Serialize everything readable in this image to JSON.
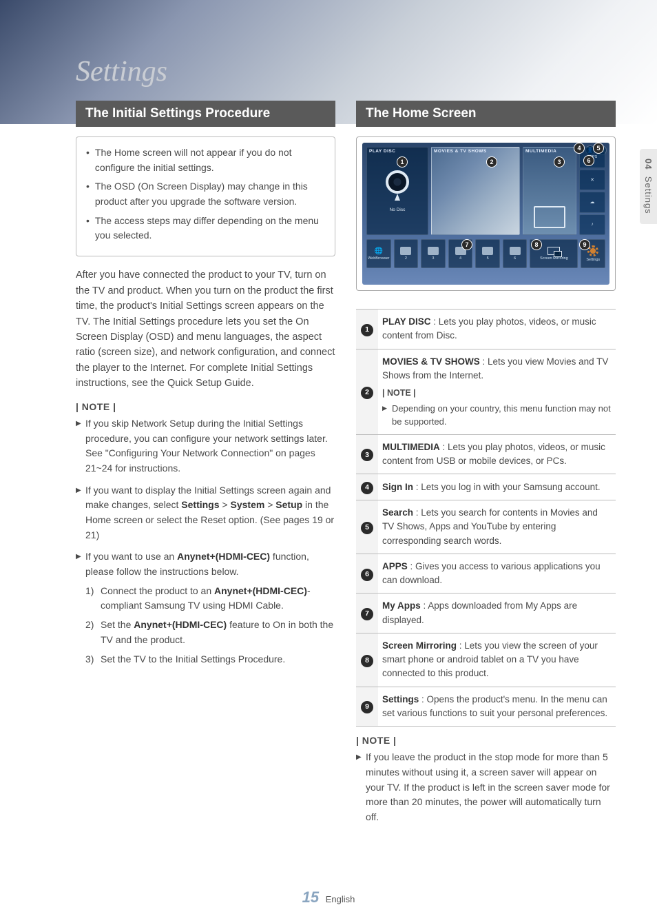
{
  "section_title": "Settings",
  "side_tab": {
    "number": "04",
    "label": "Settings"
  },
  "footer": {
    "page": "15",
    "lang": "English"
  },
  "left": {
    "heading": "The Initial Settings Procedure",
    "box_bullets": [
      "The Home screen will not appear if you do not configure the initial settings.",
      "The OSD (On Screen Display) may change in this product after you upgrade the software version.",
      "The access steps may differ depending on the menu you selected."
    ],
    "intro": "After you have connected the product to your TV, turn on the TV and product. When you turn on the product the first time, the product's Initial Settings screen appears on the TV. The Initial Settings procedure lets you set the On Screen Display (OSD) and menu languages, the aspect ratio (screen size), and network configuration, and connect the player to the Internet. For complete Initial Settings instructions, see the Quick Setup Guide.",
    "note_label": "| NOTE |",
    "notes": [
      {
        "text": "If you skip Network Setup during the Initial Settings procedure, you can configure your network settings later. See \"Configuring Your Network Connection\" on pages 21~24 for instructions."
      },
      {
        "prefix": "If you want to display the Initial Settings screen again and make changes, select ",
        "bold1": "Settings",
        "mid1": " > ",
        "bold2": "System",
        "mid2": " > ",
        "bold3": "Setup",
        "suffix": " in the Home screen or select the Reset option. (See pages 19 or 21)"
      },
      {
        "prefix": "If you want to use an ",
        "bold1": "Anynet+(HDMI-CEC)",
        "suffix": " function, please follow the instructions below.",
        "subitems": [
          {
            "num": "1)",
            "pre": "Connect the product to an ",
            "b": "Anynet+(HDMI-CEC)",
            "post": "-compliant Samsung TV using HDMI Cable."
          },
          {
            "num": "2)",
            "pre": "Set the ",
            "b": "Anynet+(HDMI-CEC)",
            "post": " feature to On in both the TV and the product."
          },
          {
            "num": "3)",
            "pre": "Set the TV to the Initial Settings Procedure.",
            "b": "",
            "post": ""
          }
        ]
      }
    ]
  },
  "right": {
    "heading": "The Home Screen",
    "thumb": {
      "play_disc": "PLAY DISC",
      "no_disc": "No Disc",
      "movies": "MOVIES & TV SHOWS",
      "multimedia": "MULTIMEDIA",
      "apps": "APPS",
      "webbrowser": "WebBrowser",
      "screen_mirroring": "Screen Mirroring",
      "settings": "Settings",
      "nums": [
        "2",
        "3",
        "4",
        "5",
        "6"
      ]
    },
    "legend": [
      {
        "n": "1",
        "title": "PLAY DISC",
        "desc": " : Lets you play photos, videos, or music content from Disc."
      },
      {
        "n": "2",
        "title": "MOVIES & TV SHOWS",
        "desc": " : Lets you view Movies and TV Shows from the Internet.",
        "note_label": "| NOTE |",
        "note_text": "Depending on your country, this menu function may not be supported."
      },
      {
        "n": "3",
        "title": "MULTIMEDIA",
        "desc": " : Lets you play photos, videos, or music content from USB or mobile devices, or PCs."
      },
      {
        "n": "4",
        "title": "Sign In",
        "desc": " : Lets you log in with your Samsung account."
      },
      {
        "n": "5",
        "title": "Search",
        "desc": " : Lets you search for contents in Movies and TV Shows, Apps and YouTube by entering corresponding search words."
      },
      {
        "n": "6",
        "title": "APPS",
        "desc": " : Gives you access to various applications you can download."
      },
      {
        "n": "7",
        "title": "My Apps",
        "desc": " : Apps downloaded from My Apps are displayed."
      },
      {
        "n": "8",
        "title": "Screen Mirroring",
        "desc": " : Lets you view the screen of your smart phone or android tablet on a TV you have connected to this product."
      },
      {
        "n": "9",
        "title": "Settings",
        "desc": " : Opens the product's menu. In the menu can set various functions to suit your personal preferences."
      }
    ],
    "bottom_note_label": "| NOTE |",
    "bottom_note": "If you leave the product in the stop mode for more than 5 minutes without using it, a screen saver will appear on your TV. If the product is left in the screen saver mode for more than 20 minutes, the power will automatically turn off."
  }
}
